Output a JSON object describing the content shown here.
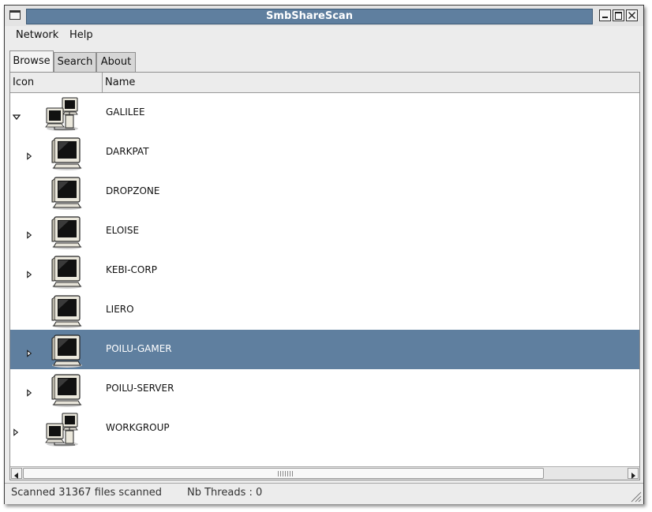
{
  "window": {
    "title": "SmbShareScan"
  },
  "menu": {
    "items": [
      "Network",
      "Help"
    ]
  },
  "tabs": [
    {
      "label": "Browse",
      "active": true
    },
    {
      "label": "Search",
      "active": false
    },
    {
      "label": "About",
      "active": false
    }
  ],
  "tree": {
    "columns": [
      "Icon",
      "Name"
    ],
    "rows": [
      {
        "name": "GALILEE",
        "icon": "network-workgroup-icon",
        "level": 0,
        "expander": "expanded",
        "selected": false
      },
      {
        "name": "DARKPAT",
        "icon": "computer-icon",
        "level": 1,
        "expander": "collapsed",
        "selected": false
      },
      {
        "name": "DROPZONE",
        "icon": "computer-icon",
        "level": 1,
        "expander": "none",
        "selected": false
      },
      {
        "name": "ELOISE",
        "icon": "computer-icon",
        "level": 1,
        "expander": "collapsed",
        "selected": false
      },
      {
        "name": "KEBI-CORP",
        "icon": "computer-icon",
        "level": 1,
        "expander": "collapsed",
        "selected": false
      },
      {
        "name": "LIERO",
        "icon": "computer-icon",
        "level": 1,
        "expander": "none",
        "selected": false
      },
      {
        "name": "POILU-GAMER",
        "icon": "computer-icon",
        "level": 1,
        "expander": "collapsed",
        "selected": true
      },
      {
        "name": "POILU-SERVER",
        "icon": "computer-icon",
        "level": 1,
        "expander": "collapsed",
        "selected": false
      },
      {
        "name": "WORKGROUP",
        "icon": "network-workgroup-icon",
        "level": 0,
        "expander": "collapsed",
        "selected": false
      }
    ]
  },
  "status": {
    "scanned": "Scanned 31367 files scanned",
    "threads": "Nb Threads : 0"
  },
  "colors": {
    "selection": "#5f7f9f",
    "title_bar": "#5f7f9f"
  }
}
